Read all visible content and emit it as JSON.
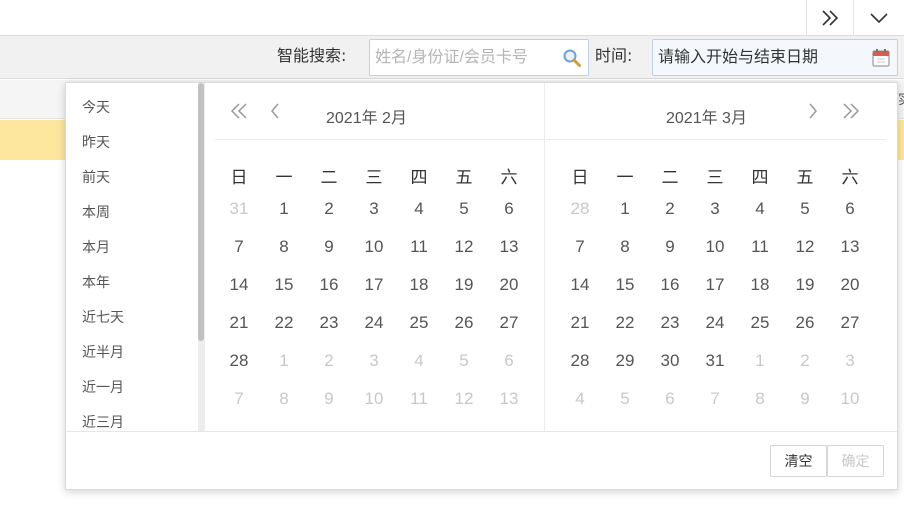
{
  "toolbar": {
    "smart_search_label": "智能搜索:",
    "search_placeholder": "姓名/身份证/会员卡号",
    "time_label": "时间:",
    "date_placeholder": "请输入开始与结束日期"
  },
  "background": {
    "edge_char": "实"
  },
  "picker": {
    "shortcuts": [
      "今天",
      "昨天",
      "前天",
      "本周",
      "本月",
      "本年",
      "近七天",
      "近半月",
      "近一月",
      "近三月"
    ],
    "weekdays": [
      "日",
      "一",
      "二",
      "三",
      "四",
      "五",
      "六"
    ],
    "left": {
      "title": "2021年  2月",
      "days": [
        [
          "31",
          "1",
          "2",
          "3",
          "4",
          "5",
          "6"
        ],
        [
          "7",
          "8",
          "9",
          "10",
          "11",
          "12",
          "13"
        ],
        [
          "14",
          "15",
          "16",
          "17",
          "18",
          "19",
          "20"
        ],
        [
          "21",
          "22",
          "23",
          "24",
          "25",
          "26",
          "27"
        ],
        [
          "28",
          "1",
          "2",
          "3",
          "4",
          "5",
          "6"
        ],
        [
          "7",
          "8",
          "9",
          "10",
          "11",
          "12",
          "13"
        ]
      ],
      "muted": [
        [
          1,
          0,
          0,
          0,
          0,
          0,
          0
        ],
        [
          0,
          0,
          0,
          0,
          0,
          0,
          0
        ],
        [
          0,
          0,
          0,
          0,
          0,
          0,
          0
        ],
        [
          0,
          0,
          0,
          0,
          0,
          0,
          0
        ],
        [
          0,
          1,
          1,
          1,
          1,
          1,
          1
        ],
        [
          1,
          1,
          1,
          1,
          1,
          1,
          1
        ]
      ]
    },
    "right": {
      "title": "2021年  3月",
      "days": [
        [
          "28",
          "1",
          "2",
          "3",
          "4",
          "5",
          "6"
        ],
        [
          "7",
          "8",
          "9",
          "10",
          "11",
          "12",
          "13"
        ],
        [
          "14",
          "15",
          "16",
          "17",
          "18",
          "19",
          "20"
        ],
        [
          "21",
          "22",
          "23",
          "24",
          "25",
          "26",
          "27"
        ],
        [
          "28",
          "29",
          "30",
          "31",
          "1",
          "2",
          "3"
        ],
        [
          "4",
          "5",
          "6",
          "7",
          "8",
          "9",
          "10"
        ]
      ],
      "muted": [
        [
          1,
          0,
          0,
          0,
          0,
          0,
          0
        ],
        [
          0,
          0,
          0,
          0,
          0,
          0,
          0
        ],
        [
          0,
          0,
          0,
          0,
          0,
          0,
          0
        ],
        [
          0,
          0,
          0,
          0,
          0,
          0,
          0
        ],
        [
          0,
          0,
          0,
          0,
          1,
          1,
          1
        ],
        [
          1,
          1,
          1,
          1,
          1,
          1,
          1
        ]
      ]
    },
    "footer": {
      "clear_label": "清空",
      "confirm_label": "确定"
    }
  },
  "icons": {
    "top_left": "double-chevron-right-icon",
    "top_right": "chevron-down-icon",
    "search": "search-icon",
    "calendar": "calendar-icon"
  },
  "colors": {
    "row_highlight": "#fde79f",
    "input_border": "#b9d3ea",
    "muted_day": "#c8c8c8"
  }
}
